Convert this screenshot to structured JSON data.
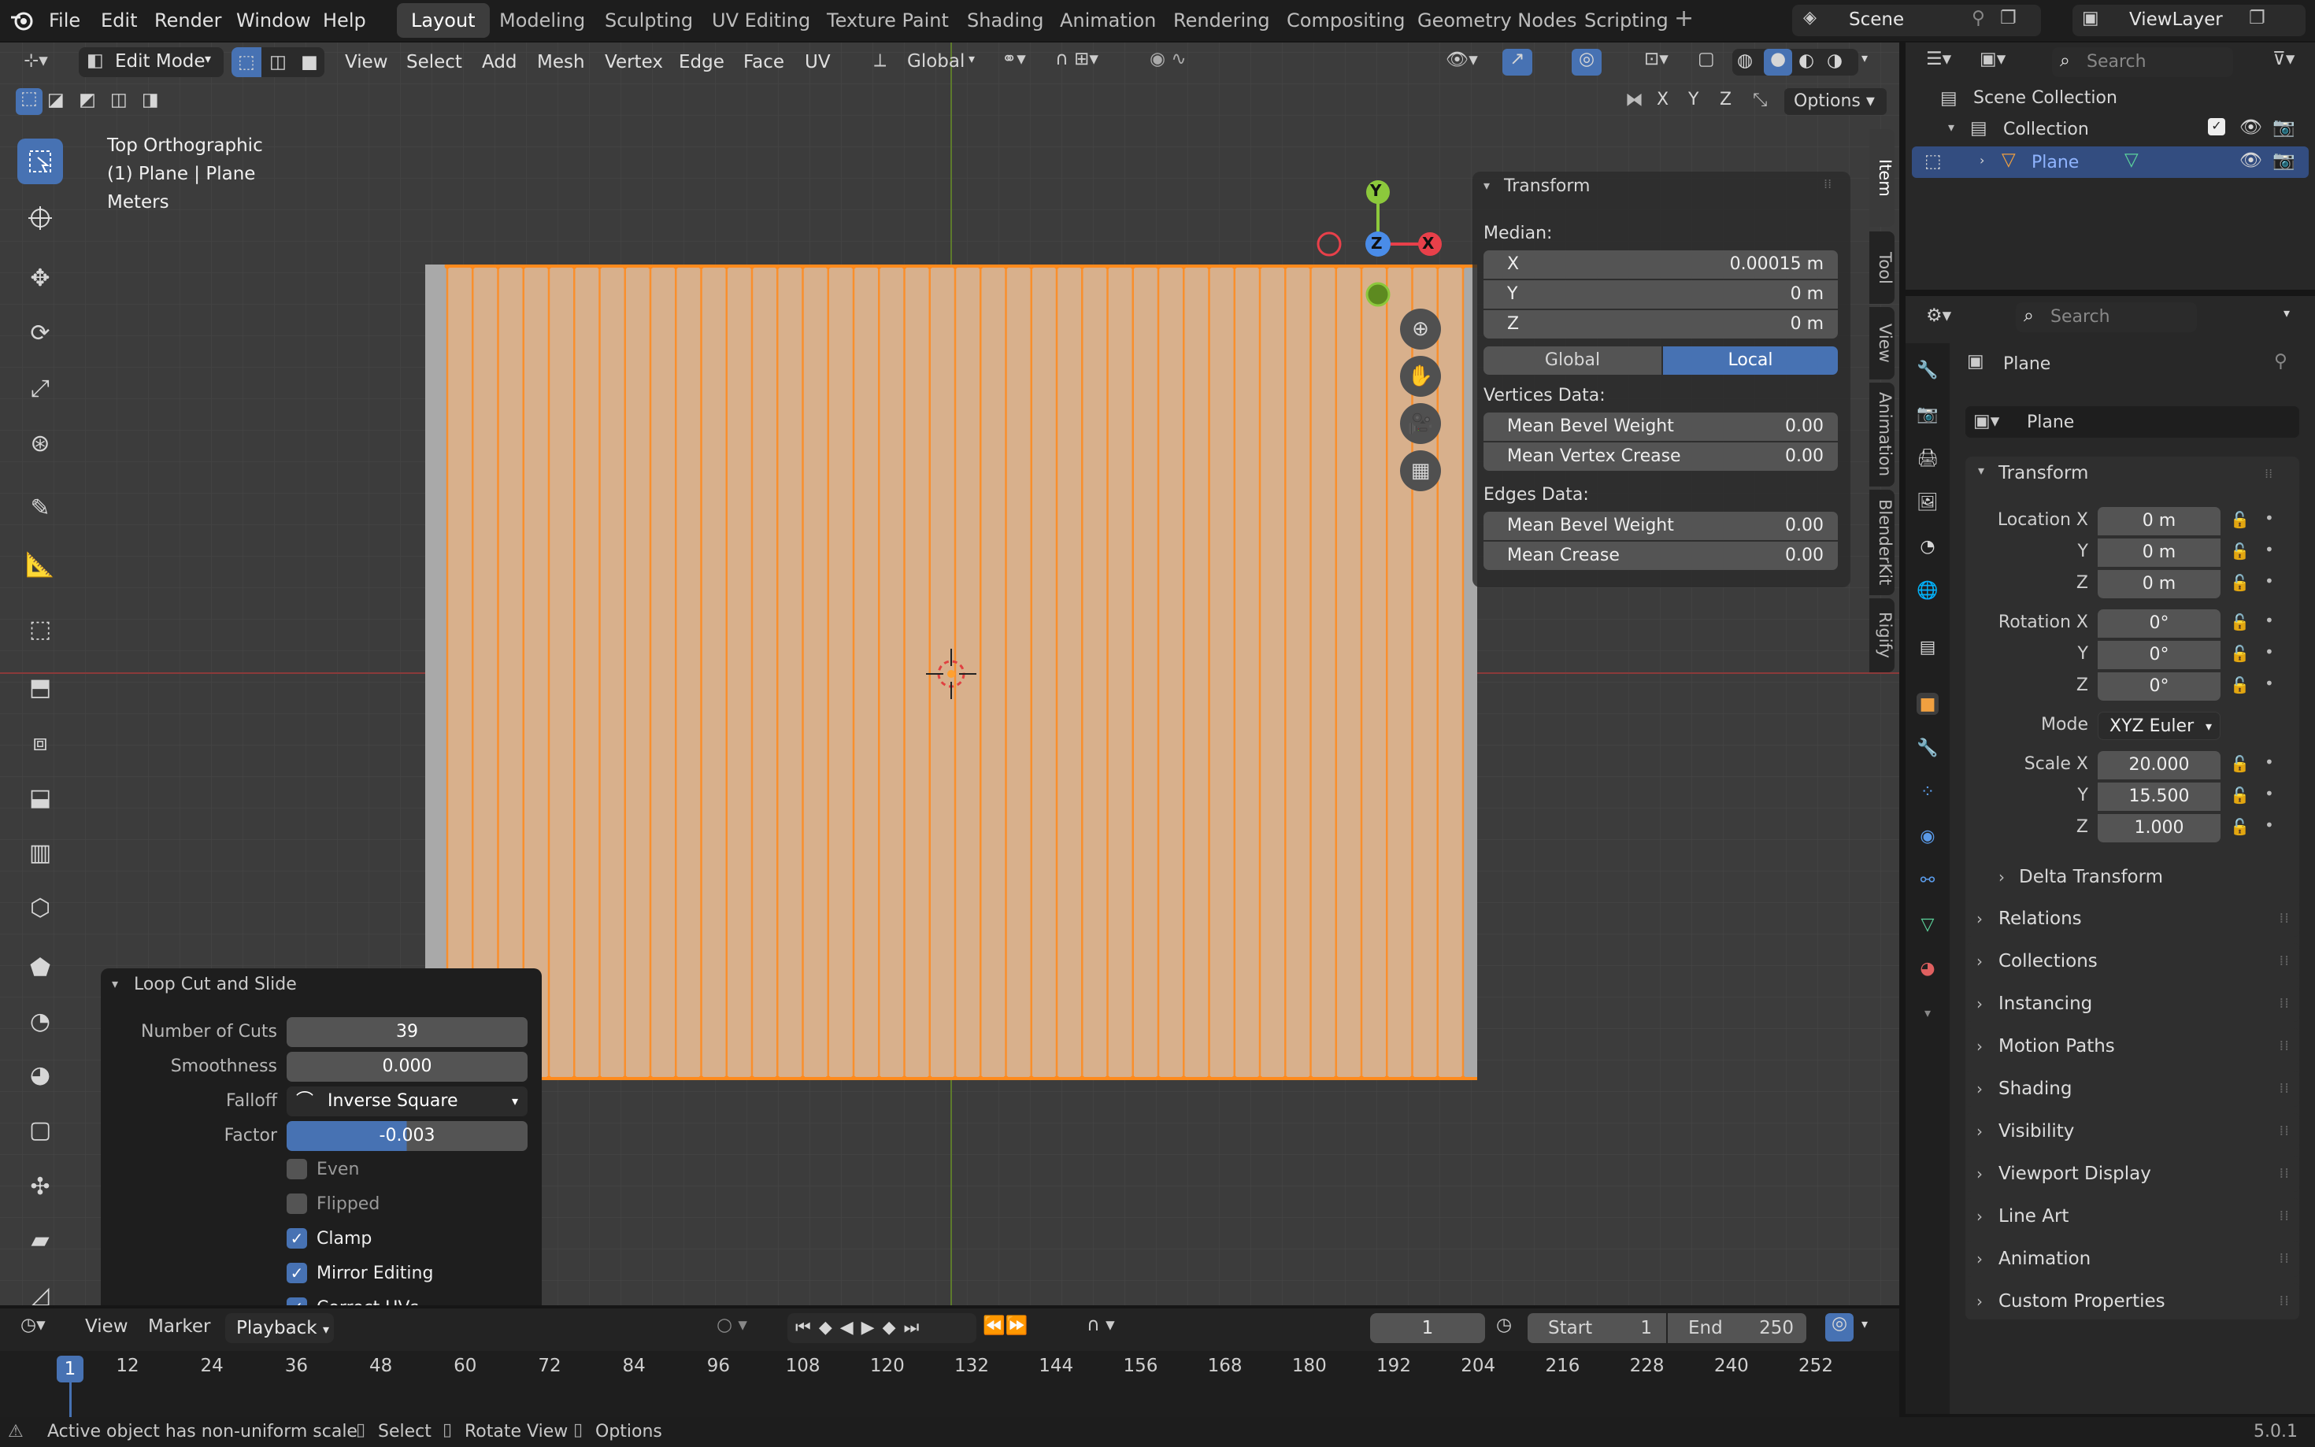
{
  "menubar": {
    "items": [
      "File",
      "Edit",
      "Render",
      "Window",
      "Help"
    ]
  },
  "workspaces": [
    "Layout",
    "Modeling",
    "Sculpting",
    "UV Editing",
    "Texture Paint",
    "Shading",
    "Animation",
    "Rendering",
    "Compositing",
    "Geometry Nodes",
    "Scripting"
  ],
  "active_workspace": "Layout",
  "scene": "Scene",
  "view_layer": "ViewLayer",
  "header": {
    "mode": "Edit Mode",
    "menus": [
      "View",
      "Select",
      "Add",
      "Mesh",
      "Vertex",
      "Edge",
      "Face",
      "UV"
    ],
    "orientation": "Global",
    "options": "Options",
    "axes": [
      "X",
      "Y",
      "Z"
    ]
  },
  "viewport": {
    "view_name": "Top Orthographic",
    "object_info": "(1) Plane | Plane",
    "units": "Meters",
    "cuts_count": 39,
    "gizmo": {
      "y": "Y",
      "z": "Z",
      "x": "X"
    }
  },
  "side_tabs": [
    "Item",
    "Tool",
    "View",
    "Animation",
    "BlenderKit",
    "Rigify"
  ],
  "npanel": {
    "title": "Transform",
    "median_label": "Median:",
    "median": [
      {
        "axis": "X",
        "value": "0.00015 m"
      },
      {
        "axis": "Y",
        "value": "0 m"
      },
      {
        "axis": "Z",
        "value": "0 m"
      }
    ],
    "global": "Global",
    "local": "Local",
    "vertices_label": "Vertices Data:",
    "vertices": [
      {
        "label": "Mean Bevel Weight",
        "value": "0.00"
      },
      {
        "label": "Mean Vertex Crease",
        "value": "0.00"
      }
    ],
    "edges_label": "Edges Data:",
    "edges": [
      {
        "label": "Mean Bevel Weight",
        "value": "0.00"
      },
      {
        "label": "Mean Crease",
        "value": "0.00"
      }
    ]
  },
  "operator": {
    "title": "Loop Cut and Slide",
    "number_of_cuts_label": "Number of Cuts",
    "number_of_cuts": "39",
    "smoothness_label": "Smoothness",
    "smoothness": "0.000",
    "falloff_label": "Falloff",
    "falloff": "Inverse Square",
    "factor_label": "Factor",
    "factor": "-0.003",
    "checks": [
      {
        "label": "Even",
        "checked": false
      },
      {
        "label": "Flipped",
        "checked": false
      },
      {
        "label": "Clamp",
        "checked": true
      },
      {
        "label": "Mirror Editing",
        "checked": true
      },
      {
        "label": "Correct UVs",
        "checked": true
      }
    ]
  },
  "outliner": {
    "search_placeholder": "Search",
    "scene_collection": "Scene Collection",
    "collection": "Collection",
    "plane": "Plane"
  },
  "properties": {
    "search_placeholder": "Search",
    "object_name": "Plane",
    "data_name": "Plane",
    "transform_title": "Transform",
    "location": [
      {
        "label": "Location X",
        "value": "0 m"
      },
      {
        "label": "Y",
        "value": "0 m"
      },
      {
        "label": "Z",
        "value": "0 m"
      }
    ],
    "rotation": [
      {
        "label": "Rotation X",
        "value": "0°"
      },
      {
        "label": "Y",
        "value": "0°"
      },
      {
        "label": "Z",
        "value": "0°"
      }
    ],
    "mode_label": "Mode",
    "mode": "XYZ Euler",
    "scale": [
      {
        "label": "Scale X",
        "value": "20.000"
      },
      {
        "label": "Y",
        "value": "15.500"
      },
      {
        "label": "Z",
        "value": "1.000"
      }
    ],
    "delta": "Delta Transform",
    "sections": [
      "Relations",
      "Collections",
      "Instancing",
      "Motion Paths",
      "Shading",
      "Visibility",
      "Viewport Display",
      "Line Art",
      "Animation",
      "Custom Properties"
    ]
  },
  "timeline": {
    "menus": [
      "View",
      "Marker",
      "Playback"
    ],
    "current_frame": "1",
    "start_label": "Start",
    "start": "1",
    "end_label": "End",
    "end": "250",
    "ticks": [
      "12",
      "24",
      "36",
      "48",
      "60",
      "72",
      "84",
      "96",
      "108",
      "120",
      "132",
      "144",
      "156",
      "168",
      "180",
      "192",
      "204",
      "216",
      "228",
      "240",
      "252"
    ],
    "playhead": "1"
  },
  "statusbar": {
    "message": "Active object has non-uniform scale",
    "hints": [
      "Select",
      "Rotate View",
      "Options"
    ],
    "version": "5.0.1"
  },
  "colors": {
    "accent": "#4772b3",
    "selection": "#ff8a1c",
    "plane_fill": "#d8b08c"
  }
}
